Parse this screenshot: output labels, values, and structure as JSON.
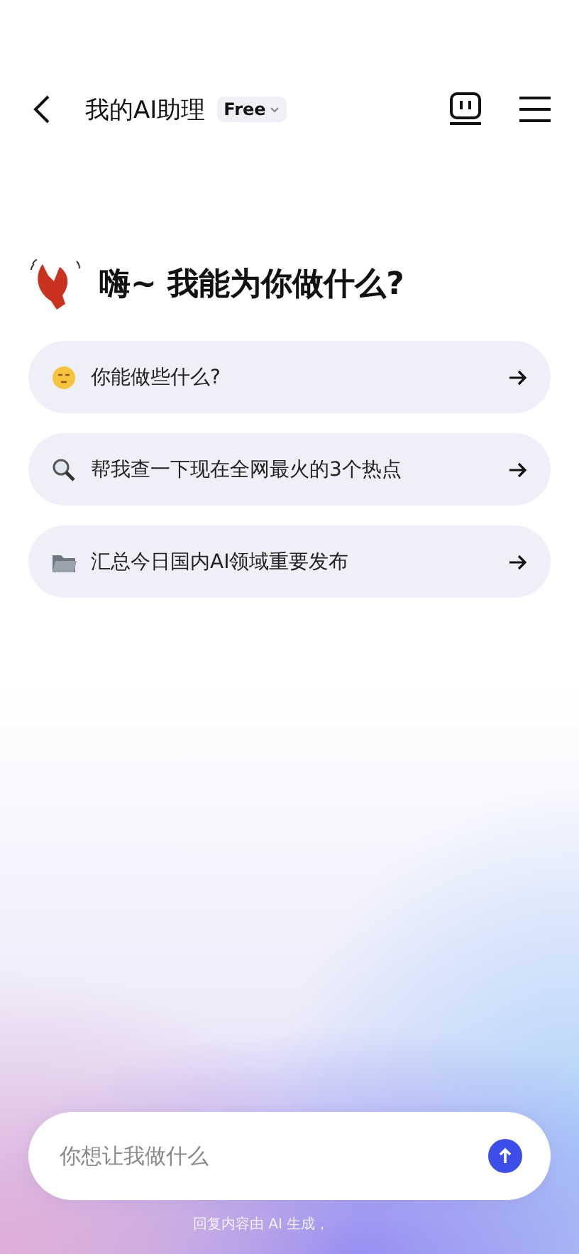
{
  "header": {
    "title": "我的AI助理",
    "plan_badge": "Free"
  },
  "greeting": "嗨~ 我能为你做什么?",
  "suggestions": [
    {
      "kind": "thinking",
      "text": "你能做些什么?"
    },
    {
      "kind": "search",
      "text": "帮我查一下现在全网最火的3个热点"
    },
    {
      "kind": "folder",
      "text": "汇总今日国内AI领域重要发布"
    }
  ],
  "input": {
    "placeholder": "你想让我做什么"
  },
  "footer_note": "回复内容由 AI 生成，"
}
